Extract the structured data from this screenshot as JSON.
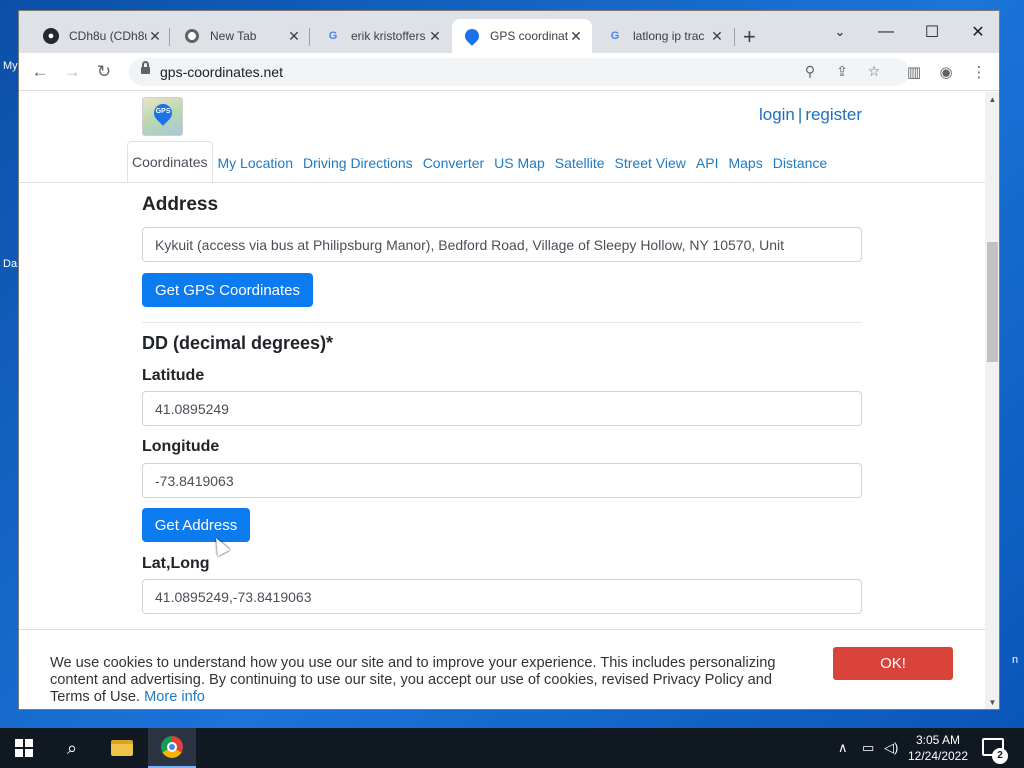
{
  "desktop": {
    "frag_my": "My",
    "frag_da": "Da",
    "frag_n": "n"
  },
  "tabs": [
    {
      "title": "CDh8u (CDh8u",
      "favicon": "github-icon"
    },
    {
      "title": "New Tab",
      "favicon": "chrome-icon"
    },
    {
      "title": "erik kristoffers",
      "favicon": "google-icon"
    },
    {
      "title": "GPS coordinat",
      "favicon": "gps-icon",
      "active": true
    },
    {
      "title": "latlong ip trac",
      "favicon": "google-icon"
    }
  ],
  "address_bar": {
    "url": "gps-coordinates.net"
  },
  "site": {
    "login": "login",
    "sep": "|",
    "register": "register",
    "logo_text": "GPS",
    "nav": [
      "Coordinates",
      "My Location",
      "Driving Directions",
      "Converter",
      "US Map",
      "Satellite",
      "Street View",
      "API",
      "Maps",
      "Distance"
    ]
  },
  "form": {
    "address_heading": "Address",
    "address_value": "Kykuit (access via bus at Philipsburg Manor), Bedford Road, Village of Sleepy Hollow, NY 10570, Unit",
    "get_gps_button": "Get GPS Coordinates",
    "dd_heading": "DD (decimal degrees)*",
    "latitude_label": "Latitude",
    "latitude_value": "41.0895249",
    "longitude_label": "Longitude",
    "longitude_value": "-73.8419063",
    "get_address_button": "Get Address",
    "latlong_label": "Lat,Long",
    "latlong_value": "41.0895249,-73.8419063"
  },
  "cookie": {
    "text": "We use cookies to understand how you use our site and to improve your experience. This includes personalizing content and advertising. By continuing to use our site, you accept our use of cookies, revised Privacy Policy and Terms of Use.",
    "more_info": "More info",
    "ok_button": "OK!"
  },
  "taskbar": {
    "time": "3:05 AM",
    "date": "12/24/2022",
    "notifications": "2"
  },
  "colors": {
    "link": "#1f7ac2",
    "button": "#0d7bf0",
    "cookie_ok": "#d9433a",
    "taskbar": "#101822"
  }
}
